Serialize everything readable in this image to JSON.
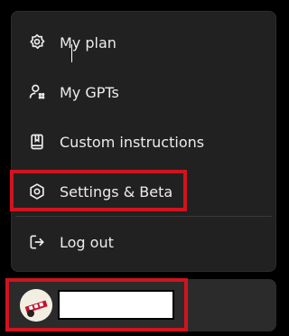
{
  "menu": {
    "items": [
      {
        "label": "My plan",
        "icon": "plan-badge-icon"
      },
      {
        "label": "My GPTs",
        "icon": "gpts-people-icon"
      },
      {
        "label": "Custom instructions",
        "icon": "instructions-book-icon"
      },
      {
        "label": "Settings & Beta",
        "icon": "gear-icon"
      },
      {
        "label": "Log out",
        "icon": "log-out-icon"
      }
    ]
  },
  "user": {
    "name": "",
    "avatar": "user-avatar"
  },
  "colors": {
    "background": "#000000",
    "menu_bg": "#212121",
    "text": "#ececec",
    "highlight": "#d0141f"
  }
}
